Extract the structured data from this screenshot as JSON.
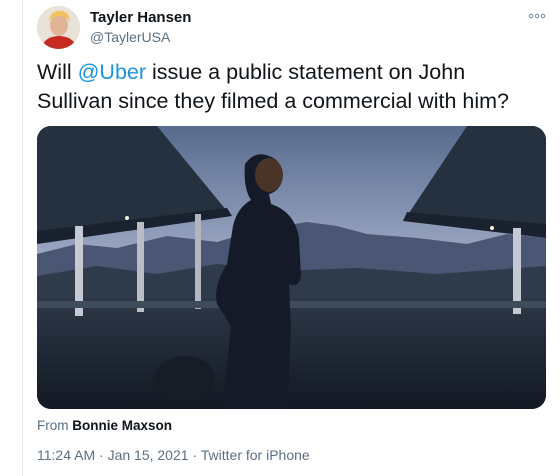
{
  "tweet": {
    "author_name": "Tayler Hansen",
    "author_handle": "@TaylerUSA",
    "text_before": "Will ",
    "mention": "@Uber",
    "text_after": " issue a public statement on John Sullivan since they filmed a commercial with him?",
    "attribution_prefix": "From ",
    "attribution_source": "Bonnie Maxson",
    "time": "11:24 AM",
    "separator": " · ",
    "date": "Jan 15, 2021",
    "client": "Twitter for iPhone"
  },
  "icons": {
    "more": "more-dots-icon",
    "avatar": "profile-avatar"
  },
  "colors": {
    "link": "#1b95e0",
    "secondary_text": "#5b7083",
    "primary_text": "#0f1419"
  }
}
